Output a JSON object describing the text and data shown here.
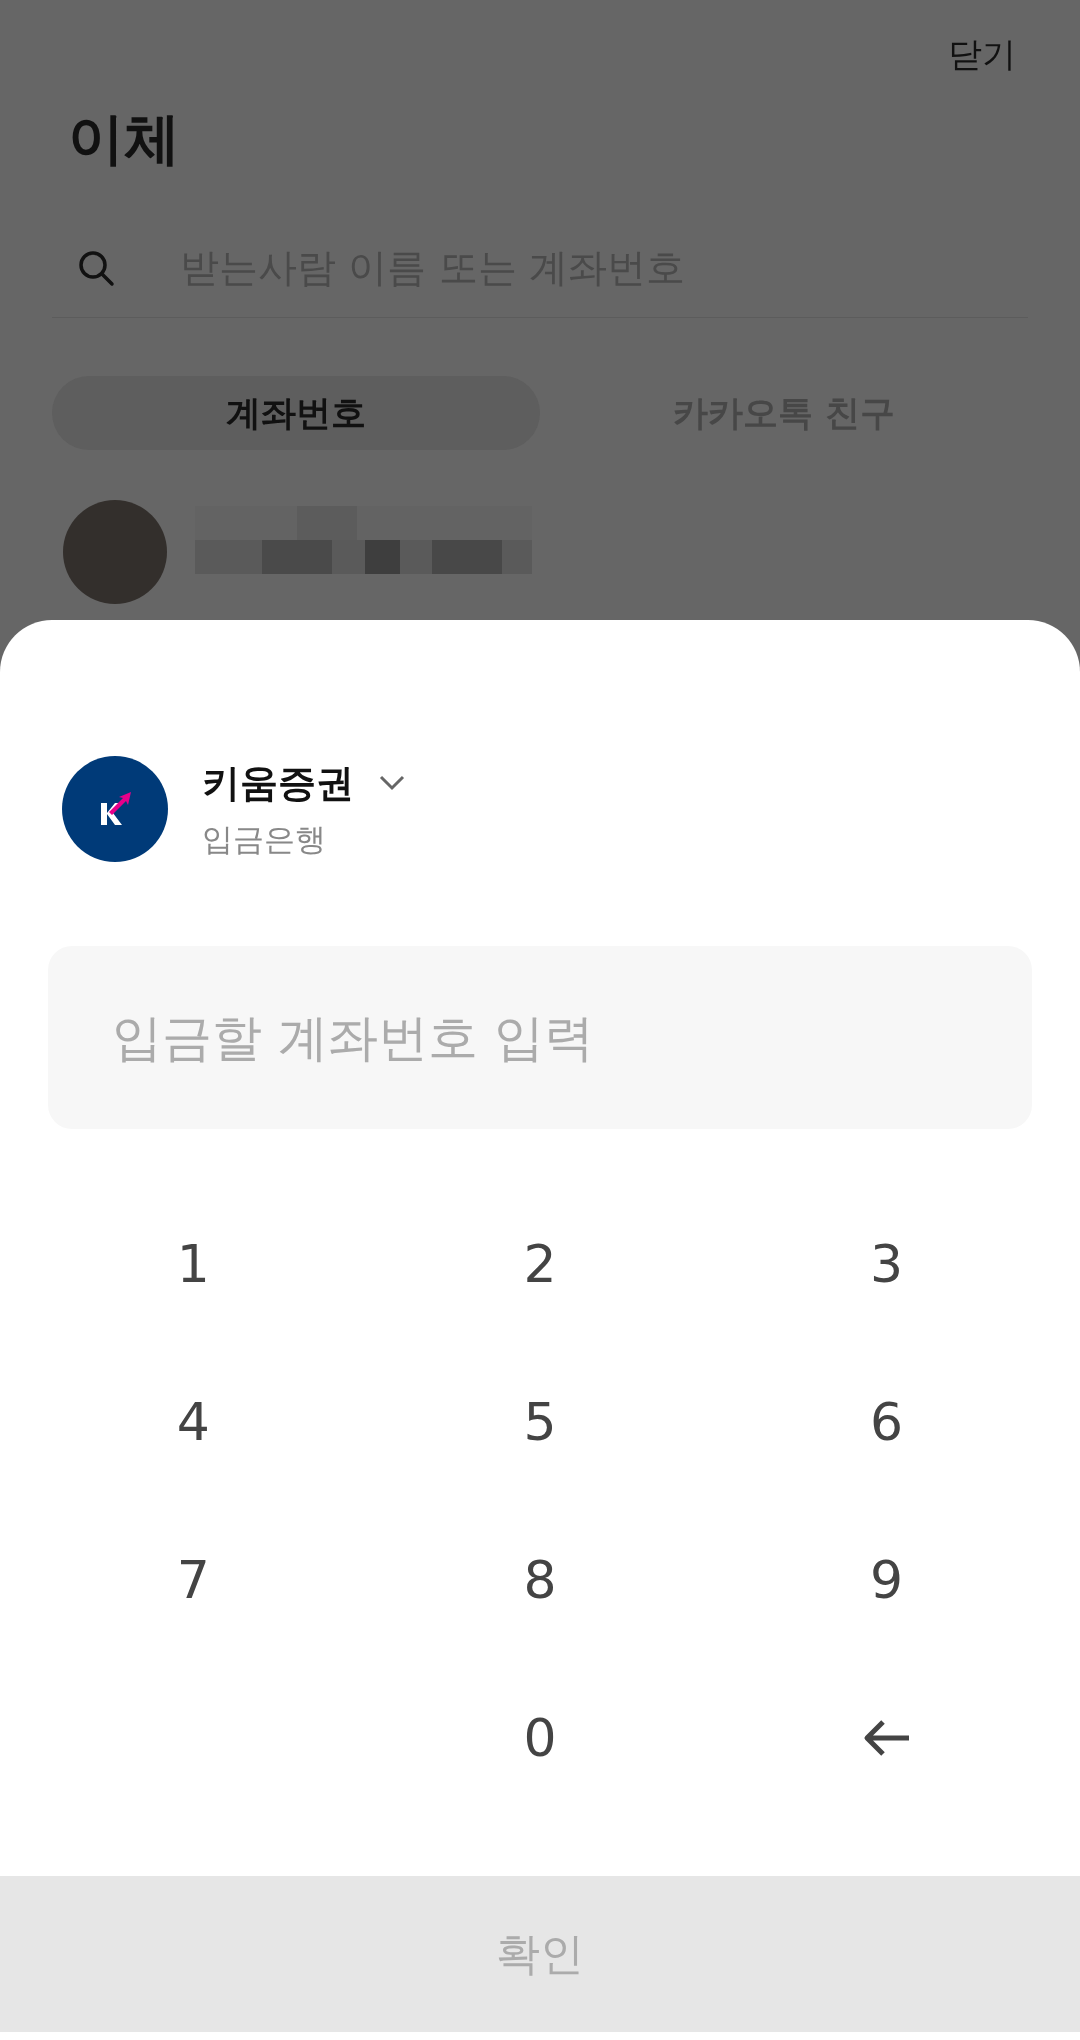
{
  "header": {
    "close": "닫기",
    "title": "이체"
  },
  "search": {
    "placeholder": "받는사람 이름 또는 계좌번호"
  },
  "tabs": [
    {
      "label": "계좌번호",
      "selected": true
    },
    {
      "label": "카카오톡 친구",
      "selected": false
    }
  ],
  "sheet": {
    "bank": {
      "name": "키움증권",
      "caption": "입금은행"
    },
    "account_field": {
      "placeholder": "입금할 계좌번호 입력"
    },
    "keypad": [
      [
        {
          "kind": "digit",
          "label": "1"
        },
        {
          "kind": "digit",
          "label": "2"
        },
        {
          "kind": "digit",
          "label": "3"
        }
      ],
      [
        {
          "kind": "digit",
          "label": "4"
        },
        {
          "kind": "digit",
          "label": "5"
        },
        {
          "kind": "digit",
          "label": "6"
        }
      ],
      [
        {
          "kind": "digit",
          "label": "7"
        },
        {
          "kind": "digit",
          "label": "8"
        },
        {
          "kind": "digit",
          "label": "9"
        }
      ],
      [
        {
          "kind": "blank"
        },
        {
          "kind": "digit",
          "label": "0"
        },
        {
          "kind": "backspace"
        }
      ]
    ],
    "confirm": {
      "label": "확인",
      "disabled": true
    }
  }
}
